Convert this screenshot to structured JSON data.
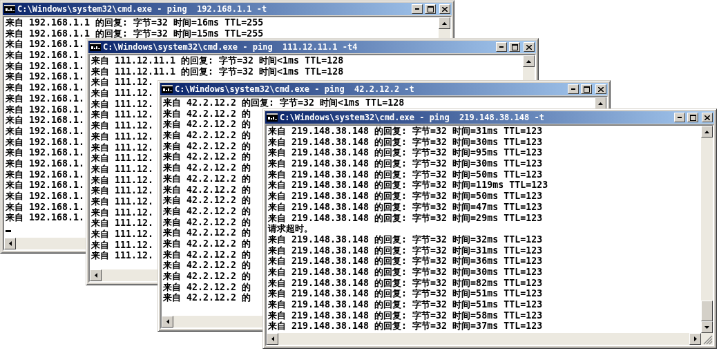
{
  "windows": [
    {
      "title": "C:\\Windows\\system32\\cmd.exe - ping  192.168.1.1 -t",
      "cursor": true,
      "lines": [
        "来自 192.168.1.1 的回复: 字节=32 时间=16ms TTL=255",
        "来自 192.168.1.1 的回复: 字节=32 时间=15ms TTL=255",
        "来自 192.168.1.",
        "来自 192.168.1.",
        "来自 192.168.1.",
        "来自 192.168.1.",
        "来自 192.168.1.",
        "来自 192.168.1.",
        "来自 192.168.1.",
        "来自 192.168.1.",
        "来自 192.168.1.",
        "来自 192.168.1.",
        "来自 192.168.1.",
        "来自 192.168.1.",
        "来自 192.168.1.",
        "来自 192.168.1.",
        "来自 192.168.1.",
        "来自 192.168.1.",
        "来自 192.168.1."
      ]
    },
    {
      "title": "C:\\Windows\\system32\\cmd.exe - ping  111.12.11.1 -t4",
      "cursor": false,
      "lines": [
        "来自 111.12.11.1 的回复: 字节=32 时间<1ms TTL=128",
        "来自 111.12.11.1 的回复: 字节=32 时间<1ms TTL=128",
        "来自 111.12.",
        "来自 111.12.",
        "来自 111.12.",
        "来自 111.12.",
        "来自 111.12.",
        "来自 111.12.",
        "来自 111.12.",
        "来自 111.12.",
        "来自 111.12.",
        "来自 111.12.",
        "来自 111.12.",
        "来自 111.12.",
        "来自 111.12.",
        "来自 111.12.",
        "来自 111.12.",
        "来自 111.12.",
        "来自 111.12."
      ]
    },
    {
      "title": "C:\\Windows\\system32\\cmd.exe - ping  42.2.12.2 -t",
      "cursor": false,
      "lines": [
        "来自 42.2.12.2 的回复: 字节=32 时间<1ms TTL=128",
        "来自 42.2.12.2 的",
        "来自 42.2.12.2 的",
        "来自 42.2.12.2 的",
        "来自 42.2.12.2 的",
        "来自 42.2.12.2 的",
        "来自 42.2.12.2 的",
        "来自 42.2.12.2 的",
        "来自 42.2.12.2 的",
        "来自 42.2.12.2 的",
        "来自 42.2.12.2 的",
        "来自 42.2.12.2 的",
        "来自 42.2.12.2 的",
        "来自 42.2.12.2 的",
        "来自 42.2.12.2 的",
        "来自 42.2.12.2 的",
        "来自 42.2.12.2 的",
        "来自 42.2.12.2 的",
        "来自 42.2.12.2 的"
      ]
    },
    {
      "title": "C:\\Windows\\system32\\cmd.exe - ping  219.148.38.148 -t",
      "cursor": false,
      "lines": [
        "来自 219.148.38.148 的回复: 字节=32 时间=31ms TTL=123",
        "来自 219.148.38.148 的回复: 字节=32 时间=30ms TTL=123",
        "来自 219.148.38.148 的回复: 字节=32 时间=95ms TTL=123",
        "来自 219.148.38.148 的回复: 字节=32 时间=30ms TTL=123",
        "来自 219.148.38.148 的回复: 字节=32 时间=50ms TTL=123",
        "来自 219.148.38.148 的回复: 字节=32 时间=119ms TTL=123",
        "来自 219.148.38.148 的回复: 字节=32 时间=50ms TTL=123",
        "来自 219.148.38.148 的回复: 字节=32 时间=47ms TTL=123",
        "来自 219.148.38.148 的回复: 字节=32 时间=29ms TTL=123",
        "请求超时。",
        "来自 219.148.38.148 的回复: 字节=32 时间=32ms TTL=123",
        "来自 219.148.38.148 的回复: 字节=32 时间=31ms TTL=123",
        "来自 219.148.38.148 的回复: 字节=32 时间=36ms TTL=123",
        "来自 219.148.38.148 的回复: 字节=32 时间=30ms TTL=123",
        "来自 219.148.38.148 的回复: 字节=32 时间=82ms TTL=123",
        "来自 219.148.38.148 的回复: 字节=32 时间=51ms TTL=123",
        "来自 219.148.38.148 的回复: 字节=32 时间=51ms TTL=123",
        "来自 219.148.38.148 的回复: 字节=32 时间=58ms TTL=123",
        "来自 219.148.38.148 的回复: 字节=32 时间=37ms TTL=123"
      ]
    }
  ]
}
